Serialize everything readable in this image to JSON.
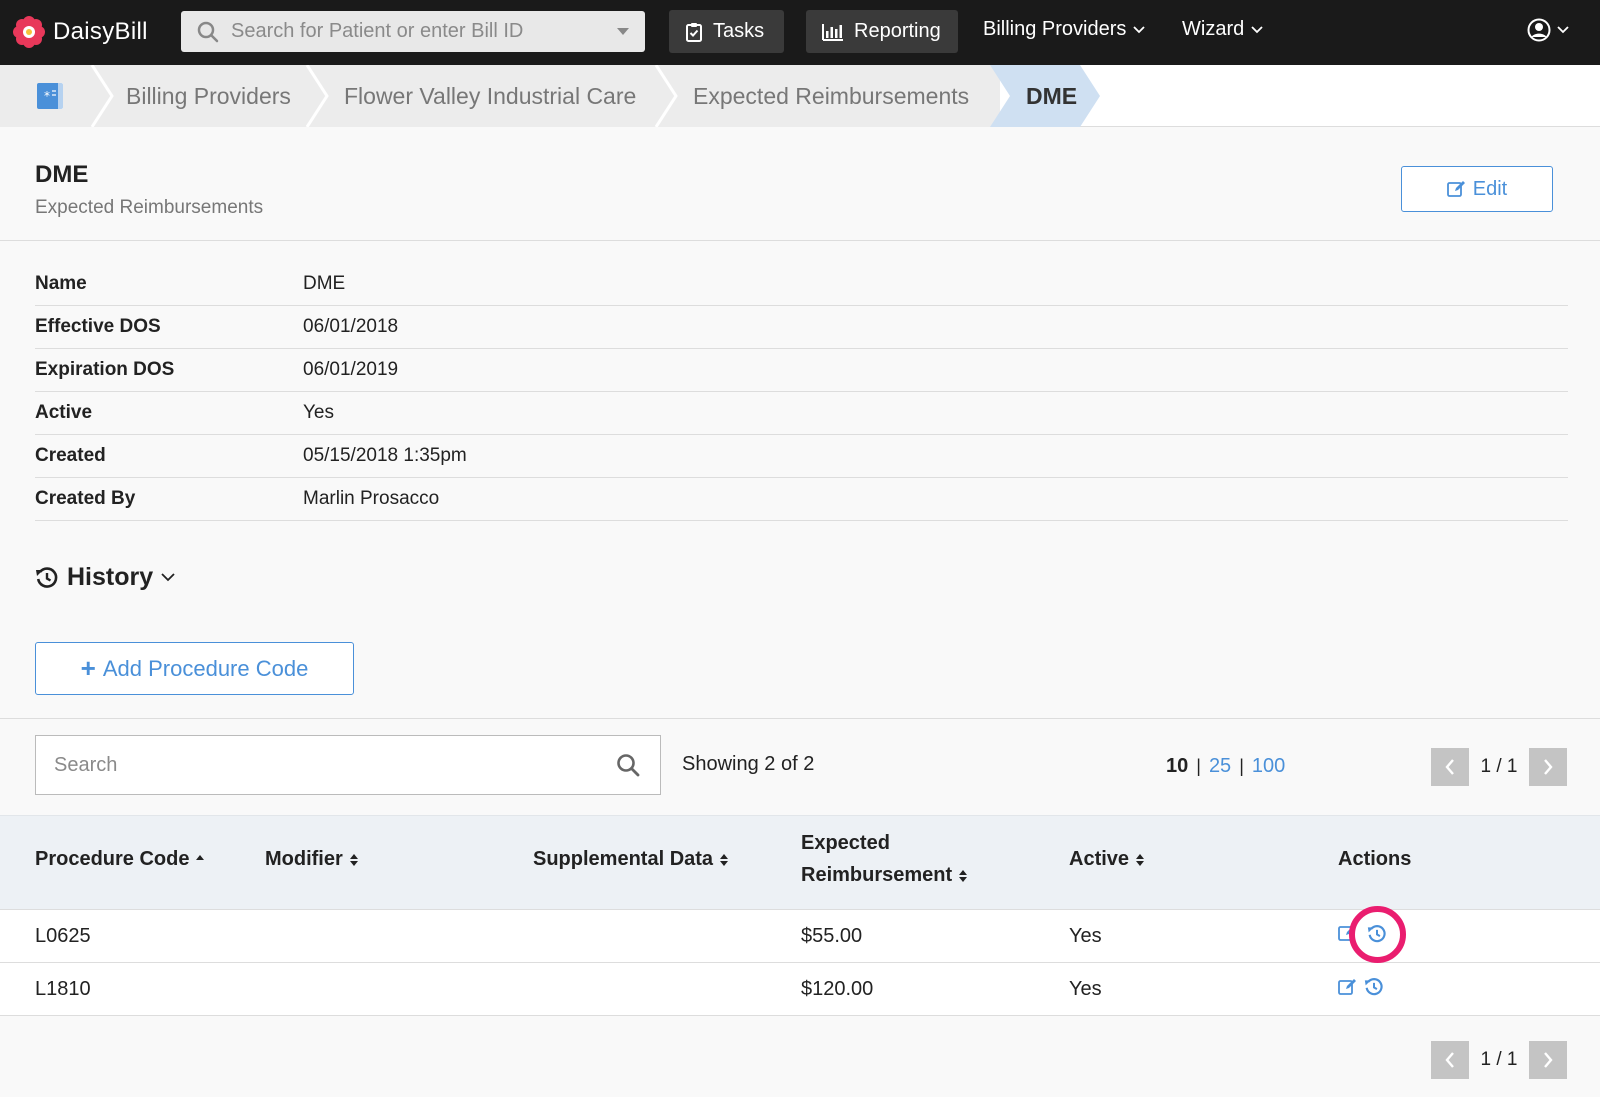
{
  "app": {
    "brand": "DaisyBill",
    "search_placeholder": "Search for Patient or enter Bill ID"
  },
  "nav": {
    "tasks": "Tasks",
    "reporting": "Reporting",
    "billing_providers": "Billing Providers",
    "wizard": "Wizard"
  },
  "breadcrumb": {
    "items": [
      "Billing Providers",
      "Flower Valley Industrial Care",
      "Expected Reimbursements"
    ],
    "active": "DME"
  },
  "header": {
    "title": "DME",
    "subtitle": "Expected Reimbursements",
    "edit_label": "Edit"
  },
  "details": [
    {
      "label": "Name",
      "value": "DME"
    },
    {
      "label": "Effective DOS",
      "value": "06/01/2018"
    },
    {
      "label": "Expiration DOS",
      "value": "06/01/2019"
    },
    {
      "label": "Active",
      "value": "Yes"
    },
    {
      "label": "Created",
      "value": "05/15/2018 1:35pm"
    },
    {
      "label": "Created By",
      "value": "Marlin Prosacco"
    }
  ],
  "history_label": "History",
  "add_procedure_label": "Add Procedure Code",
  "table_controls": {
    "search_placeholder": "Search",
    "showing": "Showing 2 of 2",
    "page_sizes": {
      "current": "10",
      "options": [
        "25",
        "100"
      ]
    },
    "page_info": "1 / 1"
  },
  "table": {
    "columns": {
      "procedure_code": "Procedure Code",
      "modifier": "Modifier",
      "supplemental": "Supplemental Data",
      "expected_line1": "Expected",
      "expected_line2": "Reimbursement",
      "active": "Active",
      "actions": "Actions"
    },
    "rows": [
      {
        "code": "L0625",
        "modifier": "",
        "supplemental": "",
        "expected": "$55.00",
        "active": "Yes"
      },
      {
        "code": "L1810",
        "modifier": "",
        "supplemental": "",
        "expected": "$120.00",
        "active": "Yes"
      }
    ]
  },
  "colors": {
    "accent": "#4a90d9",
    "highlight": "#ea1d6f",
    "nav_bg": "#1a1a1a"
  }
}
